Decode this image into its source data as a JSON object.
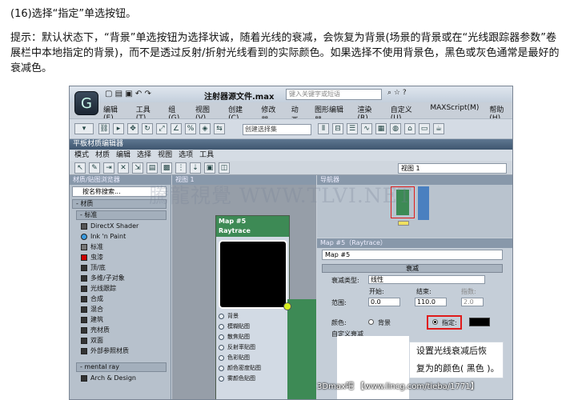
{
  "heading": "(16)选择“指定”单选按钮。",
  "tip": "提示：默认状态下，“背景”单选按钮为选择状诚，随着光线的衰减，会恢复为背景(场景的背景或在“光线跟踪器参数”卷展栏中本地指定的背景)，而不是透过反射/折射光线看到的实际颜色。如果选择不使用背景色，黑色或灰色通常是最好的衰减色。",
  "app": {
    "logo": "G",
    "window_title": "注射器源文件.max",
    "search_placeholder": "键入关键字或短语",
    "help_glyph": "?",
    "menus": [
      "编辑(E)",
      "工具(T)",
      "组(G)",
      "视图(V)",
      "创建(C)",
      "修改器",
      "动画",
      "图形编辑器",
      "渲染(R)",
      "自定义(U)",
      "MAXScript(M)",
      "帮助(H)"
    ],
    "selection_set": "创建选择集"
  },
  "editor": {
    "title": "平板材质编辑器",
    "menus": [
      "模式",
      "材质",
      "编辑",
      "选择",
      "视图",
      "选项",
      "工具"
    ],
    "view_select": "视图 1",
    "browser_title": "材质/贴图浏览器",
    "browser_search": "按名称搜索...",
    "groups": [
      "- 材质",
      "- 标准",
      "- mental ray"
    ],
    "items": [
      "DirectX Shader",
      "Ink 'n Paint",
      "标准",
      "虫漆",
      "顶/底",
      "多维/子对象",
      "光线跟踪",
      "合成",
      "混合",
      "建筑",
      "壳材质",
      "双面",
      "外部参照材质"
    ],
    "mr_items": [
      "Arch & Design"
    ],
    "view_tab": "视图 1",
    "node_title": "Map #5",
    "node_sub": "Raytrace",
    "slots": [
      "背景",
      "模糊贴图",
      "散焦贴图",
      "反射率贴图",
      "色彩贴图",
      "颜色密度贴图",
      "雾颜色贴图"
    ],
    "nav_title": "导航器",
    "props_title": "Map #5（Raytrace）",
    "props_name": "Map #5",
    "rollout": "衰减",
    "falloff_type_label": "衰减类型:",
    "falloff_type": "线性",
    "start_label": "开始:",
    "end_label": "结束:",
    "exp_label": "指数:",
    "range_label": "范围:",
    "start_val": "0.0",
    "end_val": "110.0",
    "exp_val": "2.0",
    "color_label": "颜色:",
    "bg_option": "背景",
    "specify_option": "指定:",
    "custom_label": "自定义衰减"
  },
  "callout": [
    "设置光线衰减后恢",
    "复为的颜色( 黑色 )。"
  ],
  "watermark": "騰龍視覺 WWW.TLVI.NET",
  "footer": "3Dmax吧 【www.lincg.com/tieba/1771】"
}
